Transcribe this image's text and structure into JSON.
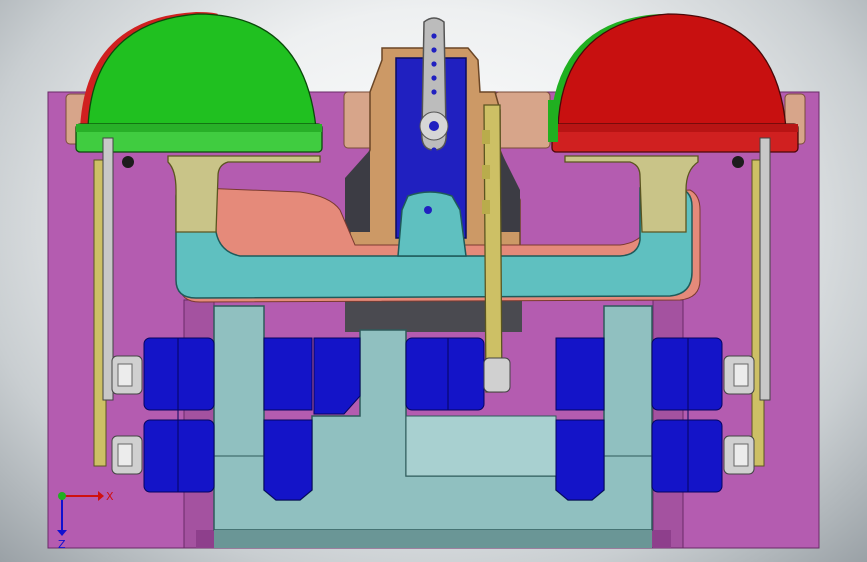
{
  "cad_view": {
    "colors": {
      "background": "#d5d9dc",
      "frame": "#b45cb0",
      "frame_dark": "#8e3f8c",
      "blue_block": "#1414c8",
      "teal_block": "#90c0c0",
      "arm": "#5fc0c0",
      "servo_bracket": "#cc9966",
      "servo": "#2020c0",
      "horn": "#bcbcbc",
      "yellow_link": "#cdc065",
      "green_dome": "#20c020",
      "red_dome": "#c01010",
      "nut": "#d0d0d0"
    },
    "triad": {
      "x_label": "X",
      "z_label": "Z"
    }
  }
}
